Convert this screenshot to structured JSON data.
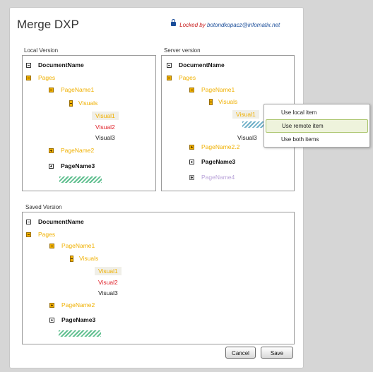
{
  "dialog": {
    "title": "Merge DXP",
    "lock": {
      "prefix": "Locked by",
      "user": "botondkopacz@infomatix.net"
    }
  },
  "local": {
    "label": "Local Version",
    "tree": {
      "document": "DocumentName",
      "pages": "Pages",
      "page1": "PageName1",
      "visuals": "Visuals",
      "visual1": "Visual1",
      "visual2": "Visual2",
      "visual3": "Visual3",
      "page2": "PageName2",
      "page3": "PageName3"
    }
  },
  "server": {
    "label": "Server version",
    "tree": {
      "document": "DocumentName",
      "pages": "Pages",
      "page1": "PageName1",
      "visuals": "Visuals",
      "visual1": "Visual1",
      "visual3": "Visual3",
      "page22": "PageName2.2",
      "page3": "PageName3",
      "page4": "PageName4"
    }
  },
  "saved": {
    "label": "Saved Version",
    "tree": {
      "document": "DocumentName",
      "pages": "Pages",
      "page1": "PageName1",
      "visuals": "Visuals",
      "visual1": "Visual1",
      "visual2": "Visual2",
      "visual3": "Visual3",
      "page2": "PageName2",
      "page3": "PageName3"
    }
  },
  "context_menu": {
    "items": [
      "Use local item",
      "Use remote item",
      "Use both items"
    ],
    "highlighted_index": 1
  },
  "buttons": {
    "cancel": "Cancel",
    "save": "Save"
  },
  "colors": {
    "gold": "#f0b000",
    "red": "#e0232b",
    "lavender": "#b9a3d9",
    "lock_red": "#c81e1e",
    "link_blue": "#1a4d99",
    "hatch_green": "#5fbf8f",
    "menu_highlight": "#eef3dc"
  }
}
